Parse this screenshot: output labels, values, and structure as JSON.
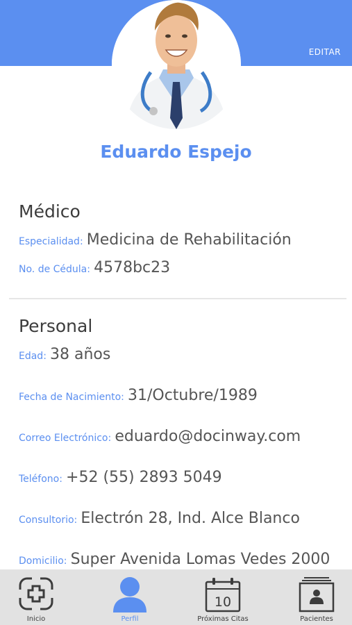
{
  "header": {
    "edit_label": "EDITAR",
    "accent_color": "#5b8ff0"
  },
  "profile": {
    "name": "Eduardo Espejo"
  },
  "medico": {
    "title": "Médico",
    "fields": [
      {
        "label": "Especialidad:",
        "value": "Medicina de Rehabilitación"
      },
      {
        "label": "No. de Cédula:",
        "value": "4578bc23"
      }
    ]
  },
  "personal": {
    "title": "Personal",
    "fields": [
      {
        "label": "Edad:",
        "value": "38 años"
      },
      {
        "label": "Fecha de Nacimiento:",
        "value": "31/Octubre/1989"
      },
      {
        "label": "Correo Electrónico:",
        "value": "eduardo@docinway.com"
      },
      {
        "label": "Teléfono:",
        "value": "+52 (55) 2893 5049"
      },
      {
        "label": "Consultorio:",
        "value": "Electrón 28, Ind. Alce Blanco"
      },
      {
        "label": "Domicilio:",
        "value": "Super Avenida Lomas Vedes 2000"
      }
    ]
  },
  "tabbar": {
    "items": [
      {
        "label": "Inicio",
        "icon": "medical-case-icon"
      },
      {
        "label": "Perfil",
        "icon": "user-icon",
        "active": true
      },
      {
        "label": "Próximas Citas",
        "icon": "calendar-icon",
        "calendar_day": "10"
      },
      {
        "label": "Pacientes",
        "icon": "patient-folder-icon"
      }
    ]
  }
}
